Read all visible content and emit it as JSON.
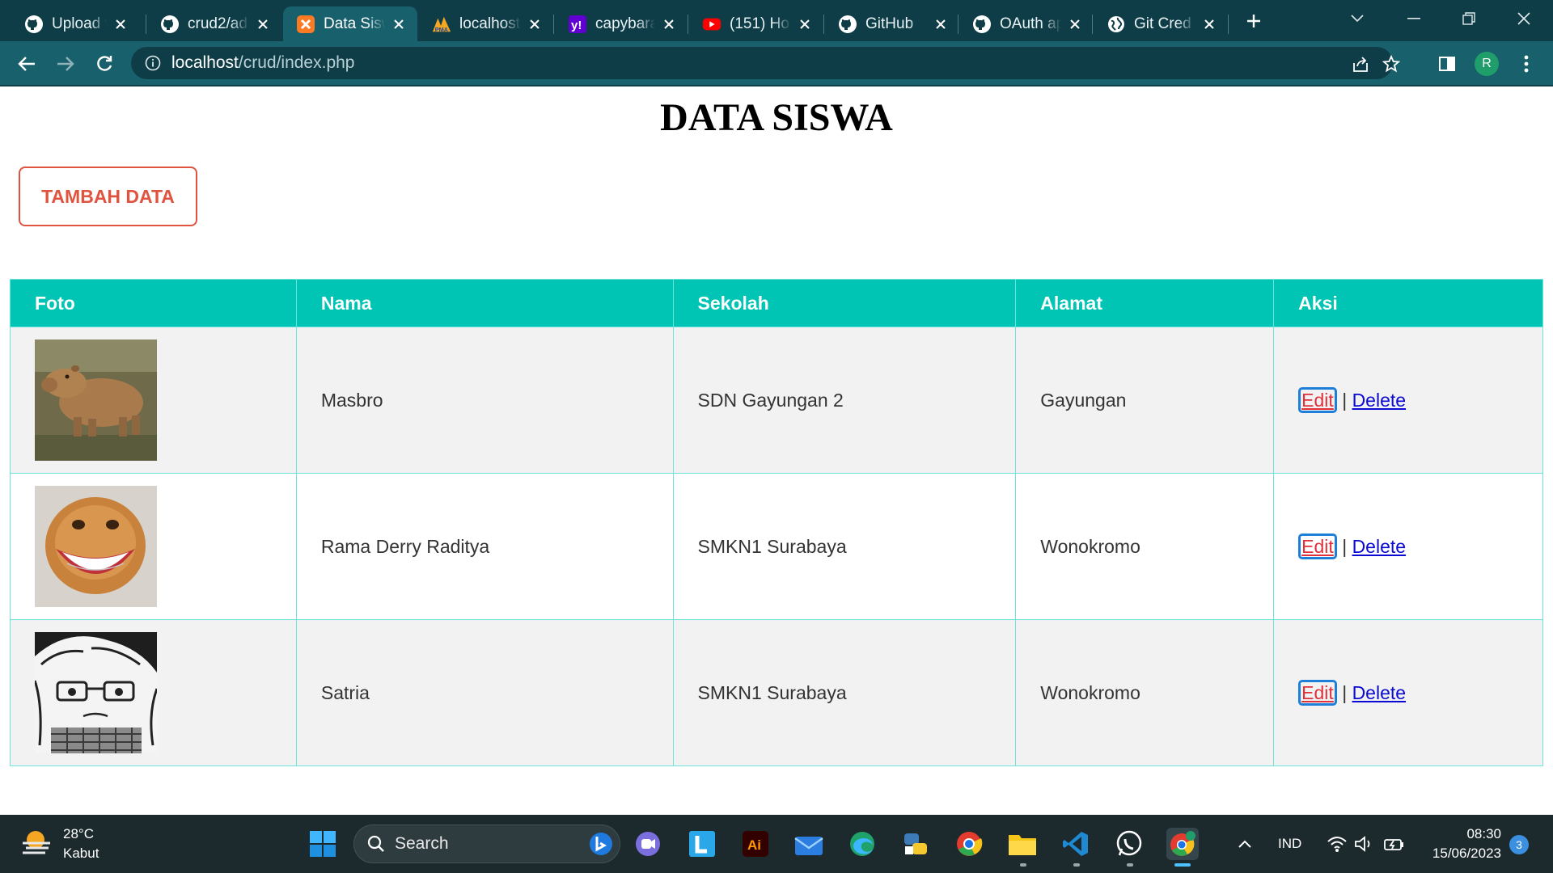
{
  "browser": {
    "tabs": [
      {
        "title": "Upload f",
        "icon": "github-icon",
        "active": false
      },
      {
        "title": "crud2/ad",
        "icon": "github-icon",
        "active": false
      },
      {
        "title": "Data Sisw",
        "icon": "xampp-icon",
        "active": true
      },
      {
        "title": "localhost",
        "icon": "phpmyadmin-icon",
        "active": false
      },
      {
        "title": "capybara",
        "icon": "yahoo-icon",
        "active": false
      },
      {
        "title": "(151) Ho",
        "icon": "youtube-icon",
        "active": false
      },
      {
        "title": "GitHub",
        "icon": "github-icon",
        "active": false
      },
      {
        "title": "OAuth ap",
        "icon": "github-icon",
        "active": false
      },
      {
        "title": "Git Cred",
        "icon": "globe-icon",
        "active": false
      }
    ],
    "url_host": "localhost",
    "url_path": "/crud/index.php",
    "profile_initial": "R",
    "theme_colors": {
      "tabstrip": "#0f3d47",
      "toolbar": "#18606b"
    }
  },
  "page": {
    "title": "DATA SISWA",
    "add_button": "TAMBAH DATA",
    "table": {
      "headers": [
        "Foto",
        "Nama",
        "Sekolah",
        "Alamat",
        "Aksi"
      ],
      "rows": [
        {
          "photo": "capybara-photo",
          "nama": "Masbro",
          "sekolah": "SDN Gayungan 2",
          "alamat": "Gayungan"
        },
        {
          "photo": "smiling-monkey-photo",
          "nama": "Rama Derry Raditya",
          "sekolah": "SMKN1 Surabaya",
          "alamat": "Wonokromo"
        },
        {
          "photo": "anime-sketch-photo",
          "nama": "Satria",
          "sekolah": "SMKN1 Surabaya",
          "alamat": "Wonokromo"
        }
      ],
      "edit_label": "Edit",
      "separator": "|",
      "delete_label": "Delete"
    },
    "colors": {
      "header_bg": "#00c4b4",
      "accent_red": "#e0533f",
      "link_blue": "#0a0ad4"
    }
  },
  "taskbar": {
    "weather_temp": "28°C",
    "weather_desc": "Kabut",
    "search_placeholder": "Search",
    "language": "IND",
    "time": "08:30",
    "date": "15/06/2023",
    "notifications": "3"
  }
}
